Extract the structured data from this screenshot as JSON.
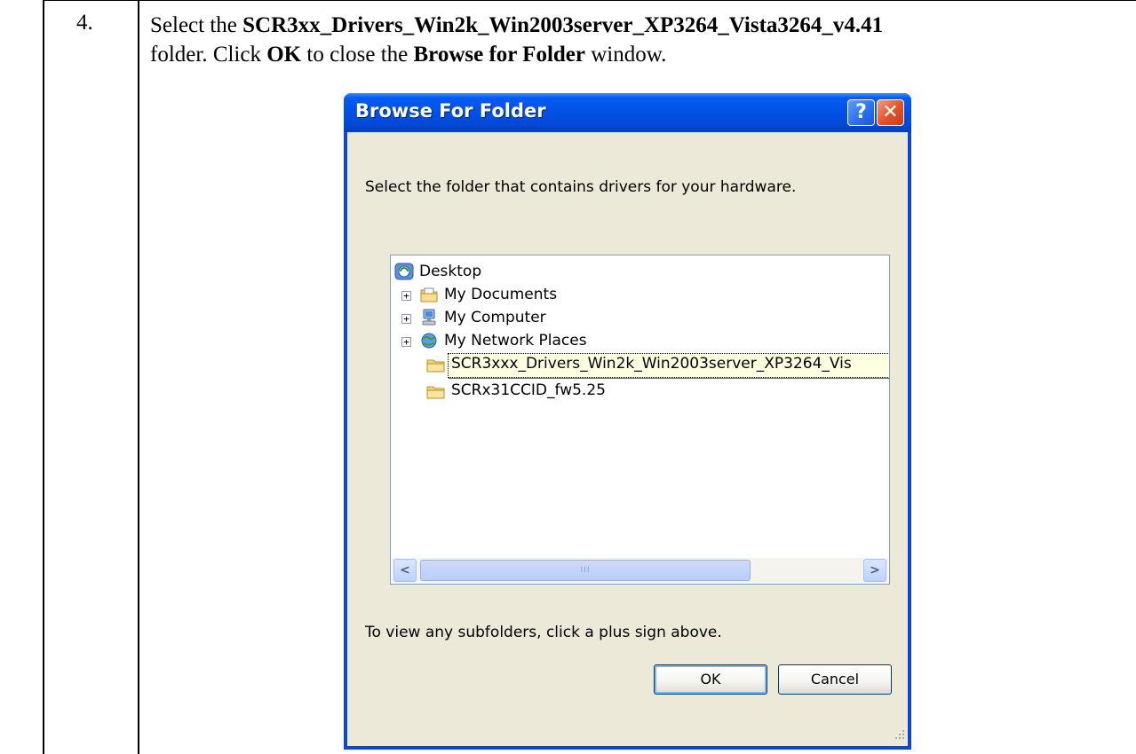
{
  "document": {
    "step_number": "4.",
    "instruction": {
      "select_prefix": "Select the ",
      "folder_name": "SCR3xx_Drivers_Win2k_Win2003server_XP3264_Vista3264_v4.41",
      "line2_prefix": "folder.  Click ",
      "ok_word": "OK",
      "line2_middle": " to close the ",
      "dialog_name": "Browse for Folder",
      "line2_suffix": " window."
    }
  },
  "dialog": {
    "title": "Browse For Folder",
    "help_glyph": "?",
    "close_glyph": "✕",
    "prompt": "Select the folder that contains drivers for your hardware.",
    "tree": {
      "root": "Desktop",
      "items": [
        {
          "label": "My Documents",
          "expander": "+",
          "icon": "my-documents-icon"
        },
        {
          "label": "My Computer",
          "expander": "+",
          "icon": "my-computer-icon"
        },
        {
          "label": "My Network Places",
          "expander": "+",
          "icon": "network-places-icon"
        },
        {
          "label": "SCR3xxx_Drivers_Win2k_Win2003server_XP3264_Vis",
          "expander": "",
          "icon": "folder-icon"
        },
        {
          "label": "SCRx31CCID_fw5.25",
          "expander": "",
          "icon": "folder-icon"
        }
      ]
    },
    "scrollbar": {
      "left_glyph": "<",
      "right_glyph": ">",
      "thumb_glyph": "III"
    },
    "hint": "To view any subfolders, click a plus sign above.",
    "ok_label": "OK",
    "cancel_label": "Cancel"
  },
  "colors": {
    "titlebar": "#0052e6",
    "client": "#ece9d8",
    "close_button": "#e0512a",
    "tooltip": "#ffffe1"
  }
}
